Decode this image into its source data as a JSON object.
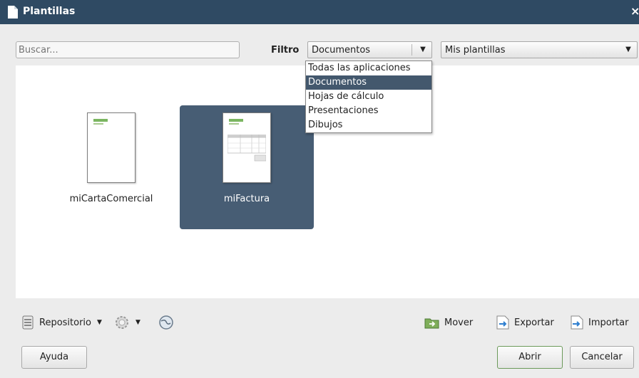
{
  "window": {
    "title": "Plantillas",
    "close_glyph": "×"
  },
  "search": {
    "placeholder": "Buscar..."
  },
  "filter": {
    "label": "Filtro",
    "selected": "Documentos",
    "options": [
      "Todas las aplicaciones",
      "Documentos",
      "Hojas de cálculo",
      "Presentaciones",
      "Dibujos"
    ],
    "selected_index": 1
  },
  "category": {
    "selected": "Mis plantillas"
  },
  "templates": [
    {
      "name": "miCartaComercial",
      "selected": false
    },
    {
      "name": "miFactura",
      "selected": true
    }
  ],
  "toolbar": {
    "repository_label": "Repositorio",
    "move_label": "Mover",
    "export_label": "Exportar",
    "import_label": "Importar",
    "icons": [
      "repository-icon",
      "settings-gear-icon",
      "globe-icon",
      "move-folder-icon",
      "export-icon",
      "import-icon"
    ]
  },
  "buttons": {
    "help": "Ayuda",
    "open": "Abrir",
    "cancel": "Cancelar"
  },
  "colors": {
    "titlebar": "#2f4a63",
    "selection": "#475d74",
    "menu_highlight": "#43586d"
  }
}
